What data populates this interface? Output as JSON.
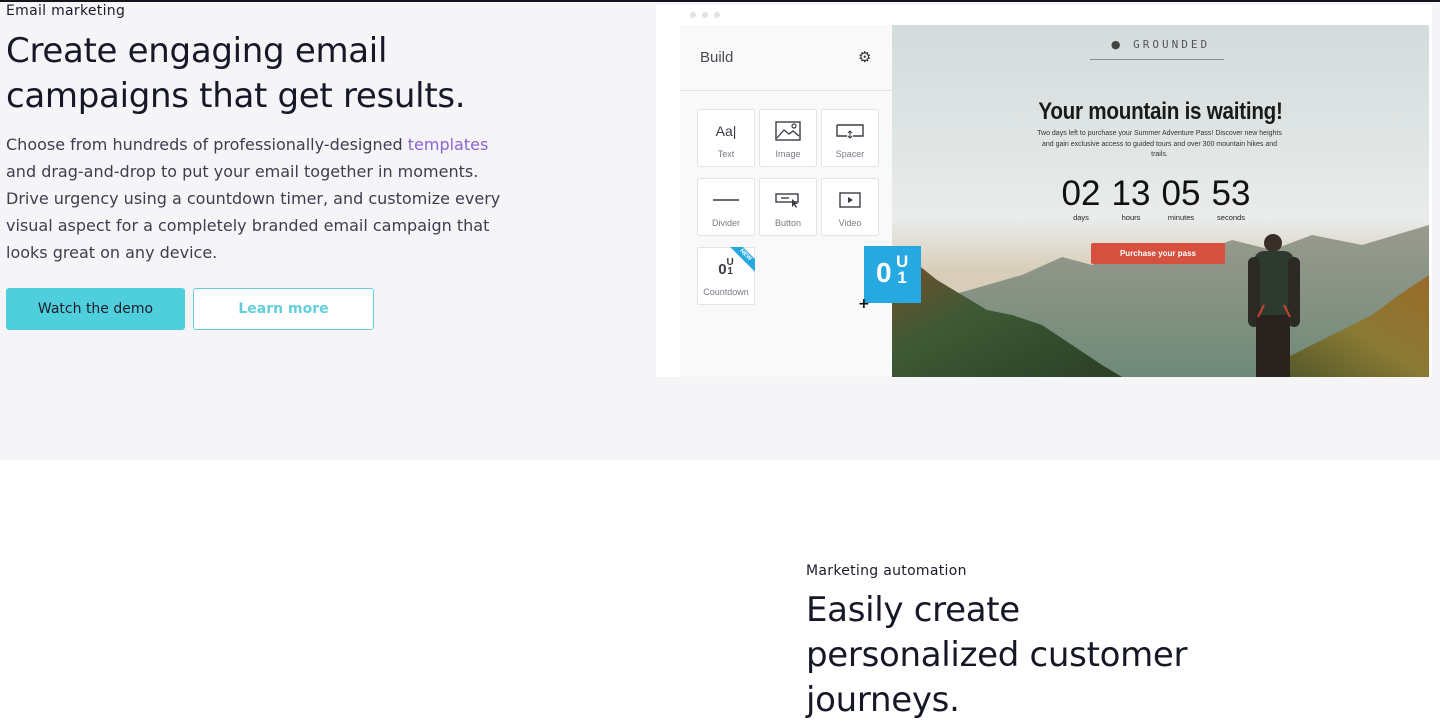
{
  "email_section": {
    "eyebrow": "Email marketing",
    "heading_line1": "Create engaging email",
    "heading_line2": "campaigns that get results.",
    "body_before_link": "Choose from hundreds of professionally-designed ",
    "body_link": "templates",
    "body_after_link": " and drag-and-drop to put your email together in moments. Drive urgency using a countdown timer, and customize every visual aspect for a completely branded email campaign that looks great on any device.",
    "primary_button": "Watch the demo",
    "secondary_button": "Learn more",
    "colors": {
      "accent": "#4fcfdb",
      "link": "#8a63d2"
    }
  },
  "builder": {
    "title": "Build",
    "settings_icon": "gear-icon",
    "blocks": [
      {
        "label": "Text",
        "icon": "text-icon",
        "glyph": "Aa|"
      },
      {
        "label": "Image",
        "icon": "image-icon"
      },
      {
        "label": "Spacer",
        "icon": "spacer-icon"
      },
      {
        "label": "Divider",
        "icon": "divider-icon"
      },
      {
        "label": "Button",
        "icon": "button-icon"
      },
      {
        "label": "Video",
        "icon": "video-icon"
      },
      {
        "label": "Countdown",
        "icon": "countdown-icon",
        "badge": "NEW"
      }
    ]
  },
  "email_preview": {
    "brand": "GROUNDED",
    "headline": "Your mountain is waiting!",
    "subtext": "Two days left to purchase your Summer Adventure Pass! Discover new heights and gain exclusive access to guided tours and over 300 mountain hikes and trails.",
    "countdown": [
      {
        "value": "02",
        "label": "days"
      },
      {
        "value": "13",
        "label": "hours"
      },
      {
        "value": "05",
        "label": "minutes"
      },
      {
        "value": "53",
        "label": "seconds"
      }
    ],
    "cta": "Purchase your pass",
    "cta_color": "#d6503f"
  },
  "automation_section": {
    "eyebrow": "Marketing automation",
    "heading_line1": "Easily create",
    "heading_line2": "personalized customer",
    "heading_line3": "journeys."
  }
}
